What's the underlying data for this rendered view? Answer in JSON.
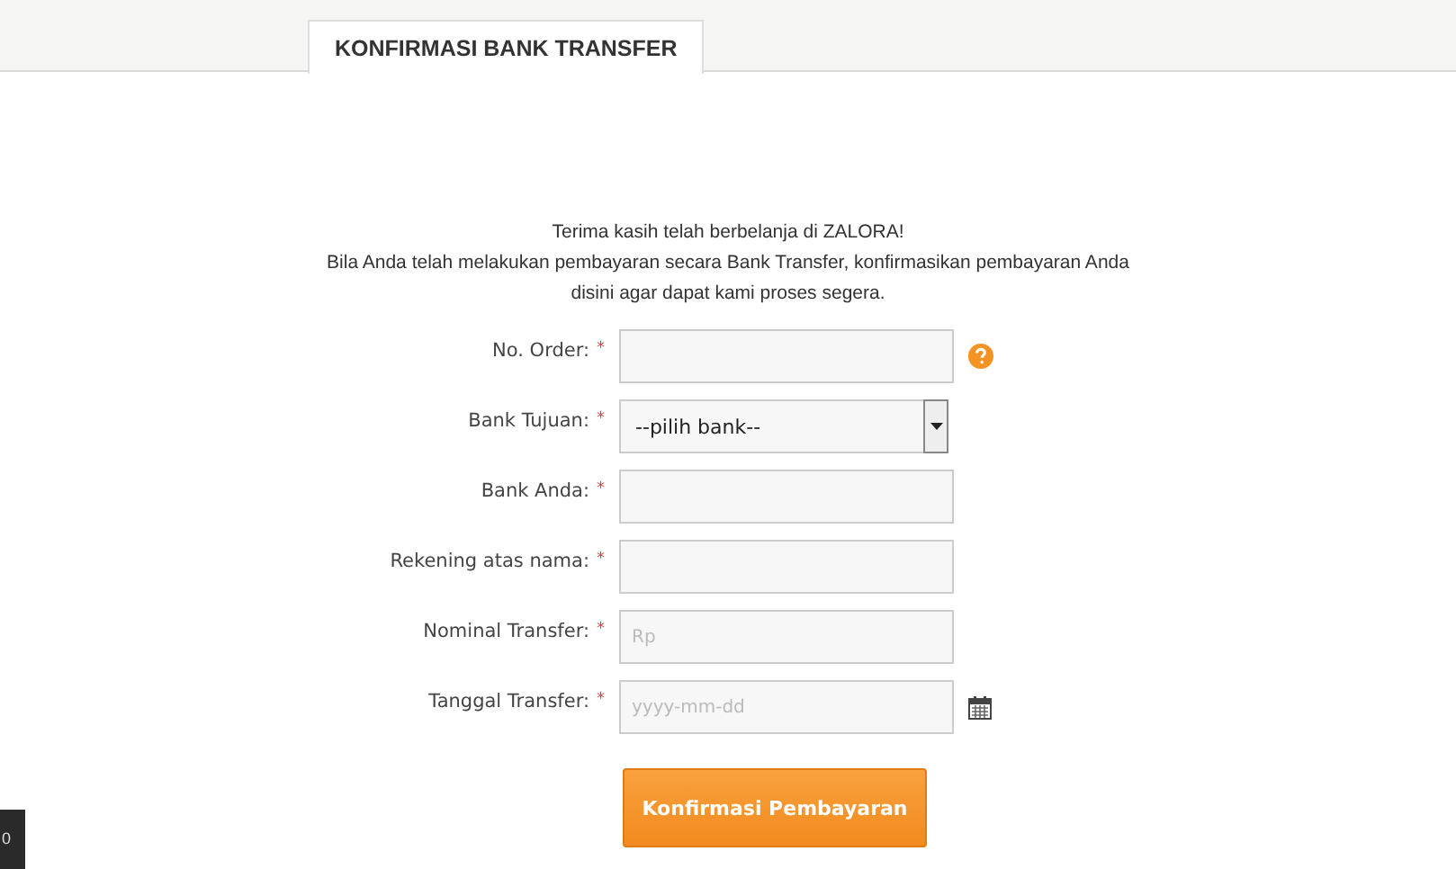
{
  "tabs": [
    {
      "label": "KONFIRMASI BANK TRANSFER",
      "selected": true
    }
  ],
  "intro": [
    "Terima kasih telah berbelanja di ZALORA!",
    "Bila Anda telah melakukan pembayaran secara Bank Transfer, konfirmasikan pembayaran Anda",
    "disini agar dapat kami proses segera."
  ],
  "fields": [
    {
      "label": "No. Order:",
      "required": "*",
      "kind": "text",
      "help": true
    },
    {
      "label": "Bank Tujuan:",
      "required": "*",
      "kind": "select",
      "value": "--pilih bank--"
    },
    {
      "label": "Bank Anda:",
      "required": "*",
      "kind": "text"
    },
    {
      "label": "Rekening atas nama:",
      "required": "*",
      "kind": "text"
    },
    {
      "label": "Nominal Transfer:",
      "required": "*",
      "kind": "text",
      "placeholder": "Rp"
    },
    {
      "label": "Tanggal Transfer:",
      "required": "*",
      "kind": "date",
      "placeholder": "yyyy-mm-dd"
    }
  ],
  "submit": "Konfirmasi Pembayaran",
  "corner_badge": "0"
}
